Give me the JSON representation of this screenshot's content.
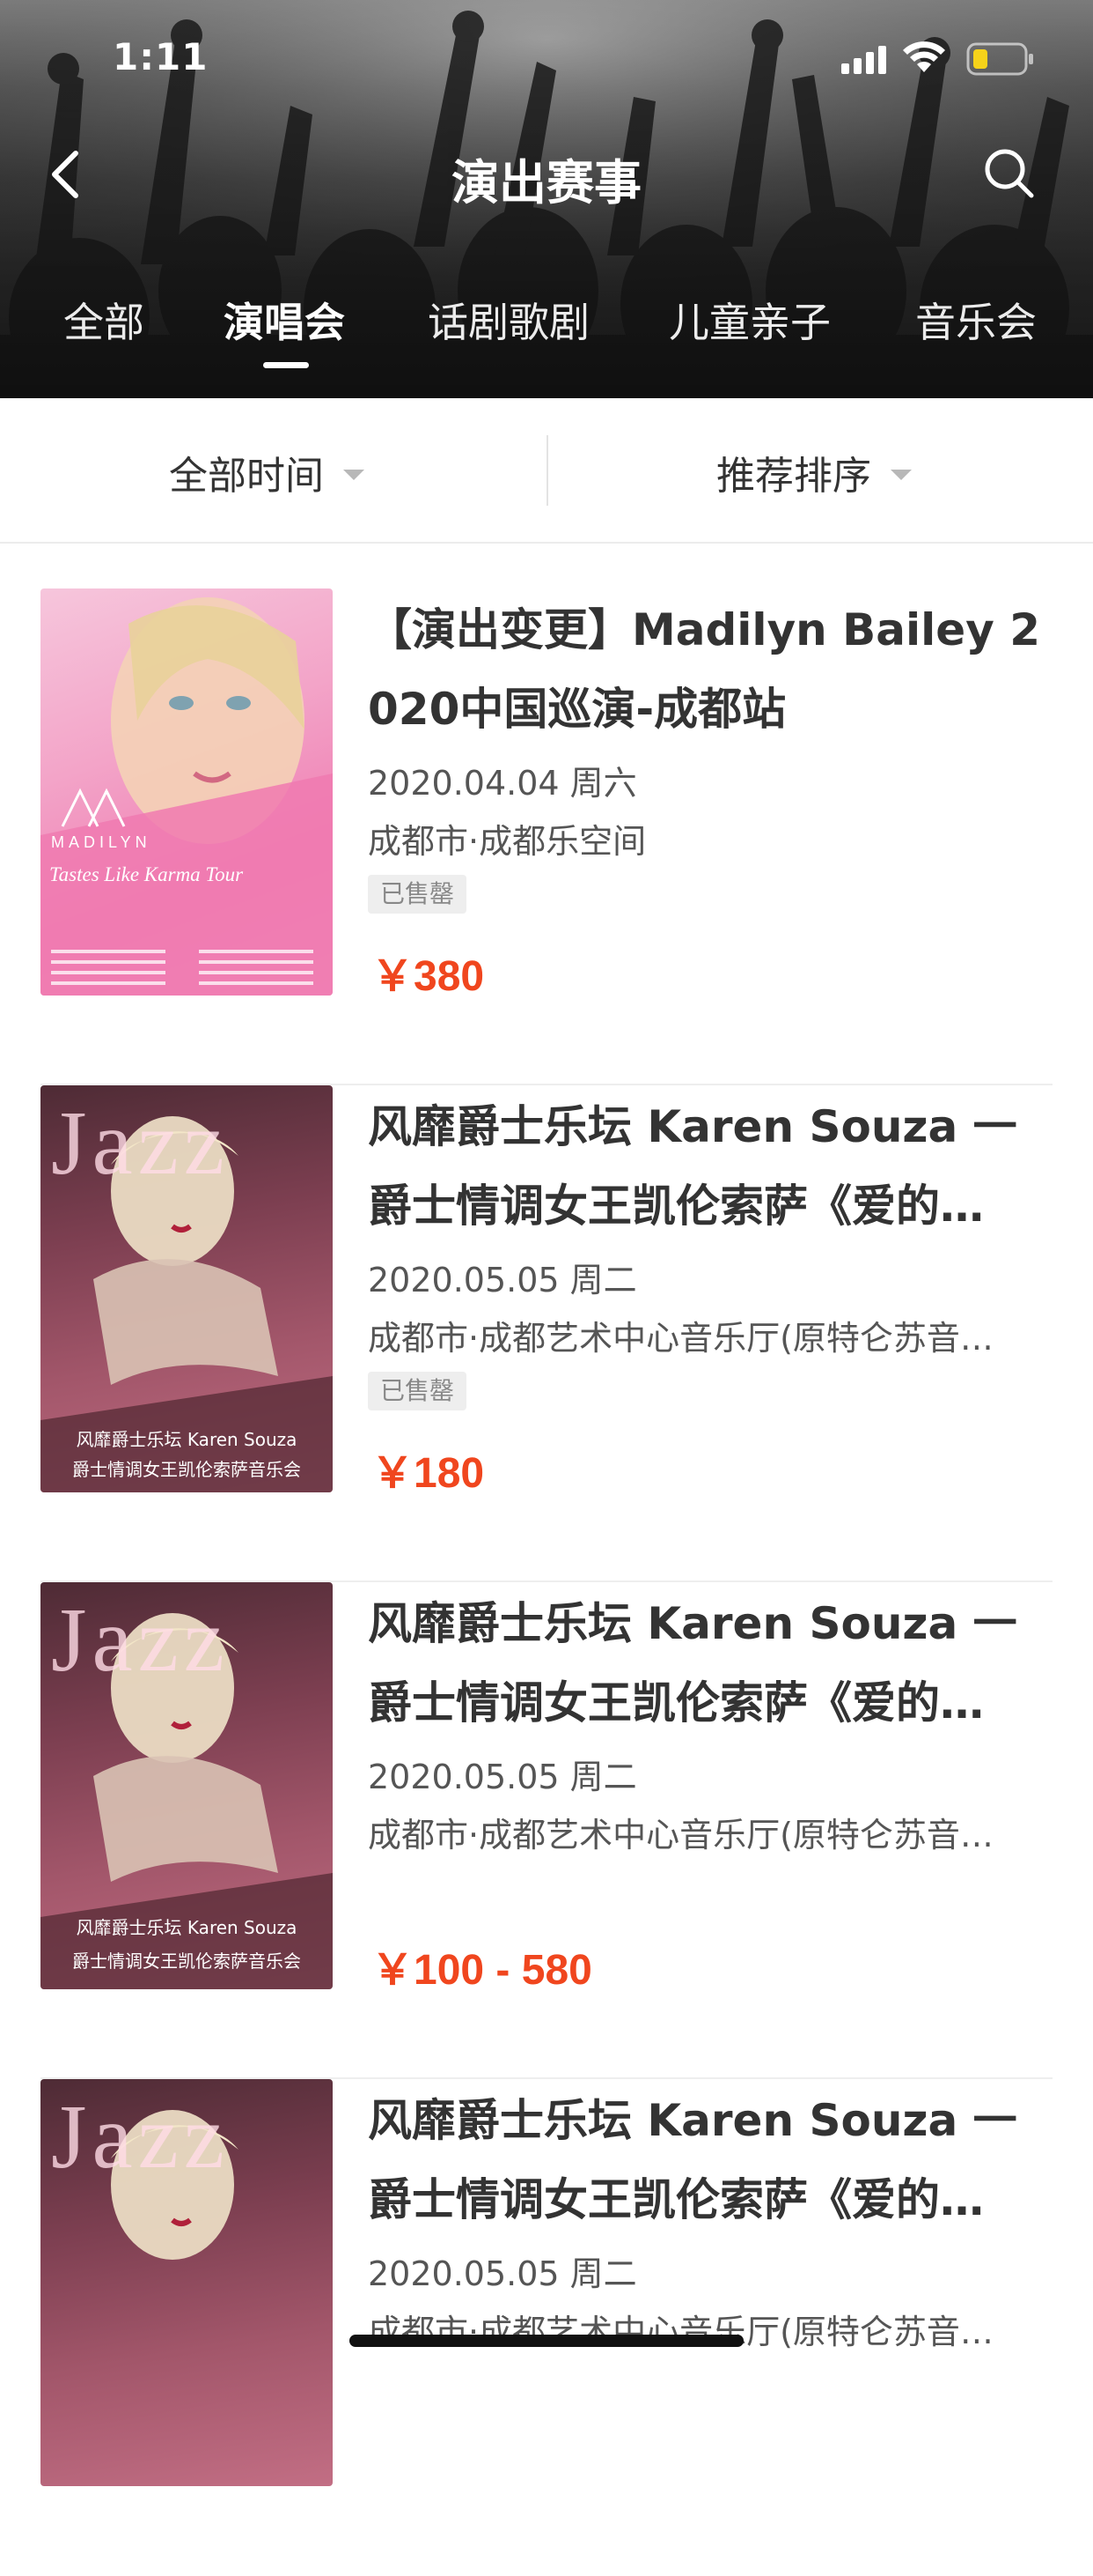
{
  "status_bar": {
    "time": "1:11"
  },
  "nav": {
    "title": "演出赛事"
  },
  "tabs": [
    {
      "label": "全部",
      "active": false
    },
    {
      "label": "演唱会",
      "active": true
    },
    {
      "label": "话剧歌剧",
      "active": false
    },
    {
      "label": "儿童亲子",
      "active": false
    },
    {
      "label": "音乐会",
      "active": false
    }
  ],
  "filters": {
    "time": "全部时间",
    "sort": "推荐排序"
  },
  "events": [
    {
      "title": "【演出变更】Madilyn Bailey 2020中国巡演-成都站",
      "date": "2020.04.04 周六",
      "venue": "成都市·成都乐空间",
      "badge": "已售罄",
      "price": "￥380",
      "poster": {
        "artist": "MADILYN",
        "tour": "Tastes Like Karma Tour"
      }
    },
    {
      "title": "风靡爵士乐坛 Karen Souza 一爵士情调女王凯伦索萨《爱的…",
      "date": "2020.05.05 周二",
      "venue": "成都市·成都艺术中心音乐厅(原特仑苏音…",
      "badge": "已售罄",
      "price": "￥180",
      "poster": {
        "word": "Jazz",
        "line1": "风靡爵士乐坛 Karen Souza",
        "line2": "爵士情调女王凯伦索萨音乐会"
      }
    },
    {
      "title": "风靡爵士乐坛 Karen Souza 一爵士情调女王凯伦索萨《爱的…",
      "date": "2020.05.05 周二",
      "venue": "成都市·成都艺术中心音乐厅(原特仑苏音…",
      "badge": "",
      "price": "￥100 - 580",
      "poster": {
        "word": "Jazz",
        "line1": "风靡爵士乐坛 Karen Souza",
        "line2": "爵士情调女王凯伦索萨音乐会"
      }
    },
    {
      "title": "风靡爵士乐坛 Karen Souza 一爵士情调女王凯伦索萨《爱的…",
      "date": "2020.05.05 周二",
      "venue": "成都市·成都艺术中心音乐厅(原特仑苏音…",
      "badge": "",
      "price": "",
      "poster": {
        "word": "Jazz",
        "line1": "",
        "line2": ""
      }
    }
  ],
  "colors": {
    "price": "#f0461e",
    "battery": "#f5d21a",
    "text_primary": "#333333"
  },
  "icons": [
    "back-arrow-icon",
    "search-icon",
    "signal-icon",
    "wifi-icon",
    "battery-icon",
    "dropdown-caret-icon"
  ]
}
